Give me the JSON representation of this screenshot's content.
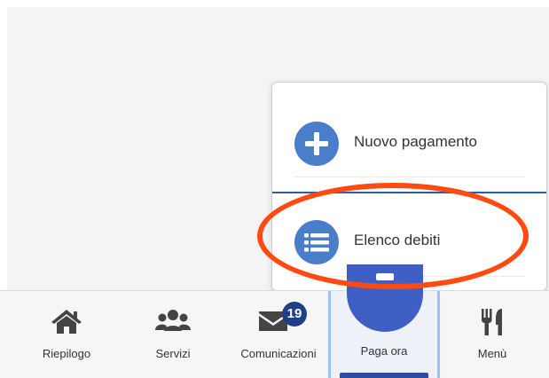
{
  "popup": {
    "items": [
      {
        "label": "Nuovo pagamento",
        "icon": "plus-circle-icon"
      },
      {
        "label": "Elenco debiti",
        "icon": "list-circle-icon"
      }
    ]
  },
  "tabbar": {
    "tabs": [
      {
        "label": "Riepilogo",
        "icon": "home-icon"
      },
      {
        "label": "Servizi",
        "icon": "users-icon"
      },
      {
        "label": "Comunicazioni",
        "icon": "envelope-icon",
        "badge": "19"
      },
      {
        "label": "Paga ora",
        "icon": "pay-icon"
      },
      {
        "label": "Menù",
        "icon": "utensils-icon"
      }
    ]
  },
  "colors": {
    "accent_blue": "#4a7ecb",
    "dark_blue": "#1f3f86",
    "highlight_red": "#ff4a12"
  }
}
